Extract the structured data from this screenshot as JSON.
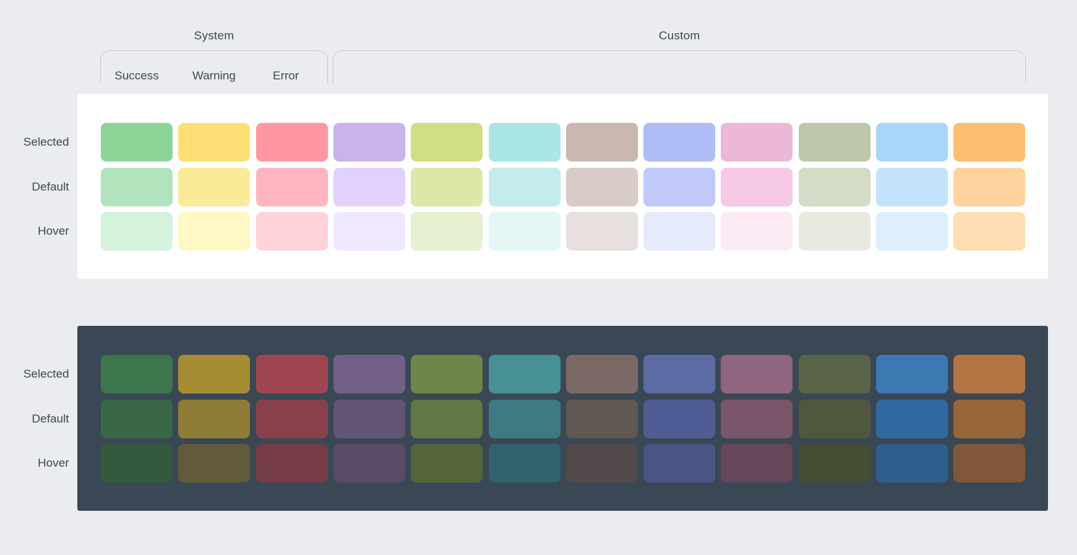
{
  "header": {
    "system_label": "System",
    "custom_label": "Custom",
    "columns": [
      "Success",
      "Warning",
      "Error"
    ]
  },
  "rows": [
    "Selected",
    "Default",
    "Hover"
  ],
  "palettes": {
    "light": {
      "Selected": [
        "#8dd499",
        "#ffe077",
        "#fe97a2",
        "#cbb2eb",
        "#d0de84",
        "#a9e6e6",
        "#cab7b0",
        "#afbdf4",
        "#ecb8d8",
        "#bdc7a9",
        "#a8d5fa",
        "#ffbe6f"
      ],
      "Default": [
        "#b1e4bd",
        "#fbeb98",
        "#feb5bf",
        "#e3d1fd",
        "#dde7a8",
        "#c4ecec",
        "#d9cbc6",
        "#c1c9fb",
        "#f6cae6",
        "#d4dbc6",
        "#c5e2fb",
        "#ffd39e"
      ],
      "Hover": [
        "#d5f2dd",
        "#fff8c4",
        "#ffd3da",
        "#f2e8fe",
        "#e7f0cf",
        "#e4f6f6",
        "#e8e0df",
        "#e6eafd",
        "#fcebf4",
        "#e7eadf",
        "#ddeefd",
        "#ffdeb6"
      ]
    },
    "dark": {
      "Selected": [
        "#3d754c",
        "#a68d33",
        "#9f4550",
        "#726088",
        "#6c8748",
        "#469096",
        "#7a6964",
        "#5d6ba3",
        "#8f6580",
        "#5a6448",
        "#3c78b1",
        "#b37543"
      ],
      "Default": [
        "#3a6745",
        "#8f7c36",
        "#8a404a",
        "#625474",
        "#607843",
        "#3e7a84",
        "#615753",
        "#505d94",
        "#7a566a",
        "#4f583f",
        "#316aa1",
        "#986639"
      ],
      "Hover": [
        "#335a3d",
        "#625b3b",
        "#753c45",
        "#594b66",
        "#54653b",
        "#30636e",
        "#52494a",
        "#4a5585",
        "#664659",
        "#454d35",
        "#2e5e8c",
        "#805738"
      ]
    }
  }
}
